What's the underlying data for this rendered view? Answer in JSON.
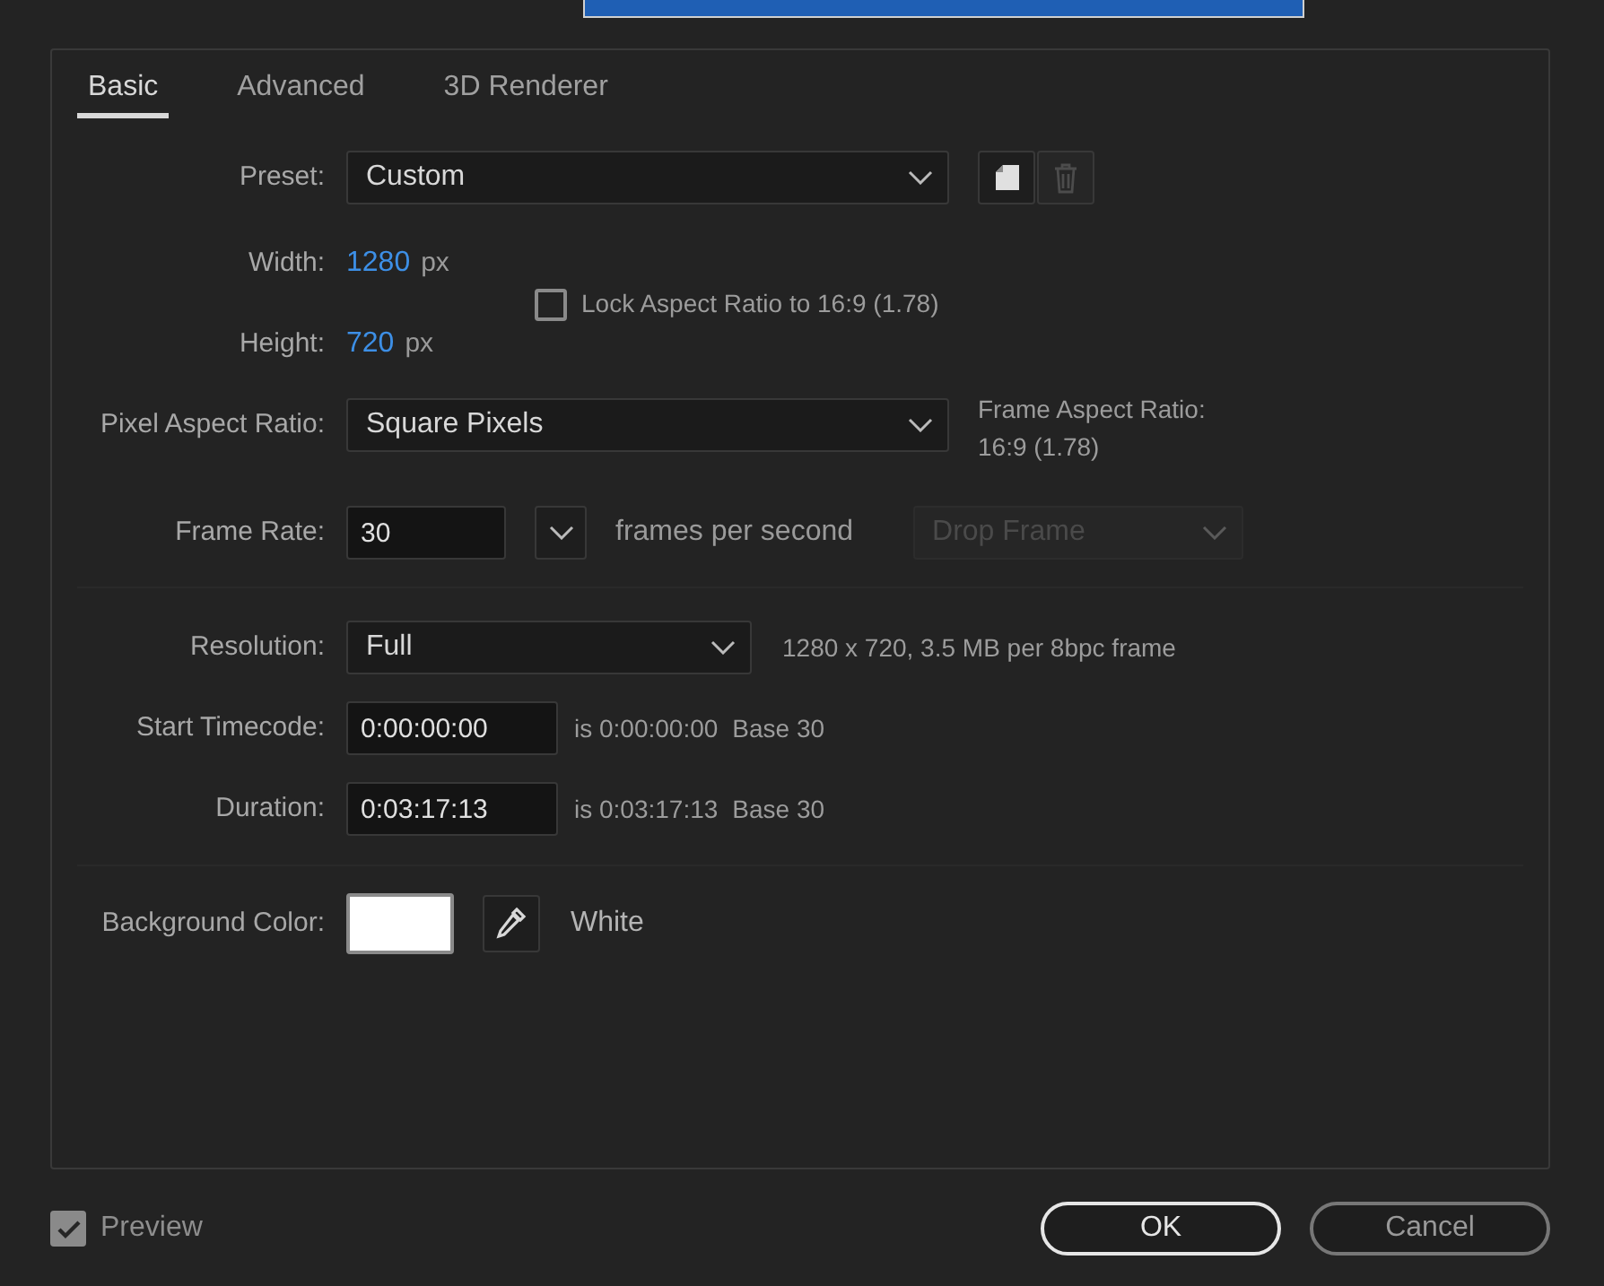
{
  "tabs": [
    {
      "label": "Basic",
      "selected": true
    },
    {
      "label": "Advanced",
      "selected": false
    },
    {
      "label": "3D Renderer",
      "selected": false
    }
  ],
  "preset": {
    "label": "Preset:",
    "value": "Custom"
  },
  "width": {
    "label": "Width:",
    "value": "1280",
    "unit": "px"
  },
  "height": {
    "label": "Height:",
    "value": "720",
    "unit": "px"
  },
  "lock_aspect": {
    "label": "Lock Aspect Ratio to 16:9 (1.78)",
    "checked": false
  },
  "pixel_aspect": {
    "label": "Pixel Aspect Ratio:",
    "value": "Square Pixels"
  },
  "frame_aspect": {
    "label": "Frame Aspect Ratio:",
    "value": "16:9 (1.78)"
  },
  "frame_rate": {
    "label": "Frame Rate:",
    "value": "30",
    "unit": "frames per second",
    "drop_frame": {
      "value": "Drop Frame",
      "disabled": true
    }
  },
  "resolution": {
    "label": "Resolution:",
    "value": "Full",
    "info": "1280 x 720, 3.5 MB per 8bpc frame"
  },
  "start_timecode": {
    "label": "Start Timecode:",
    "value": "0:00:00:00",
    "info": "is 0:00:00:00",
    "base": "Base 30"
  },
  "duration": {
    "label": "Duration:",
    "value": "0:03:17:13",
    "info": "is 0:03:17:13",
    "base": "Base 30"
  },
  "background_color": {
    "label": "Background Color:",
    "color": "#ffffff",
    "name": "White"
  },
  "preview": {
    "label": "Preview",
    "checked": true
  },
  "buttons": [
    {
      "label": "OK",
      "kind": "default"
    },
    {
      "label": "Cancel",
      "kind": "normal"
    }
  ]
}
